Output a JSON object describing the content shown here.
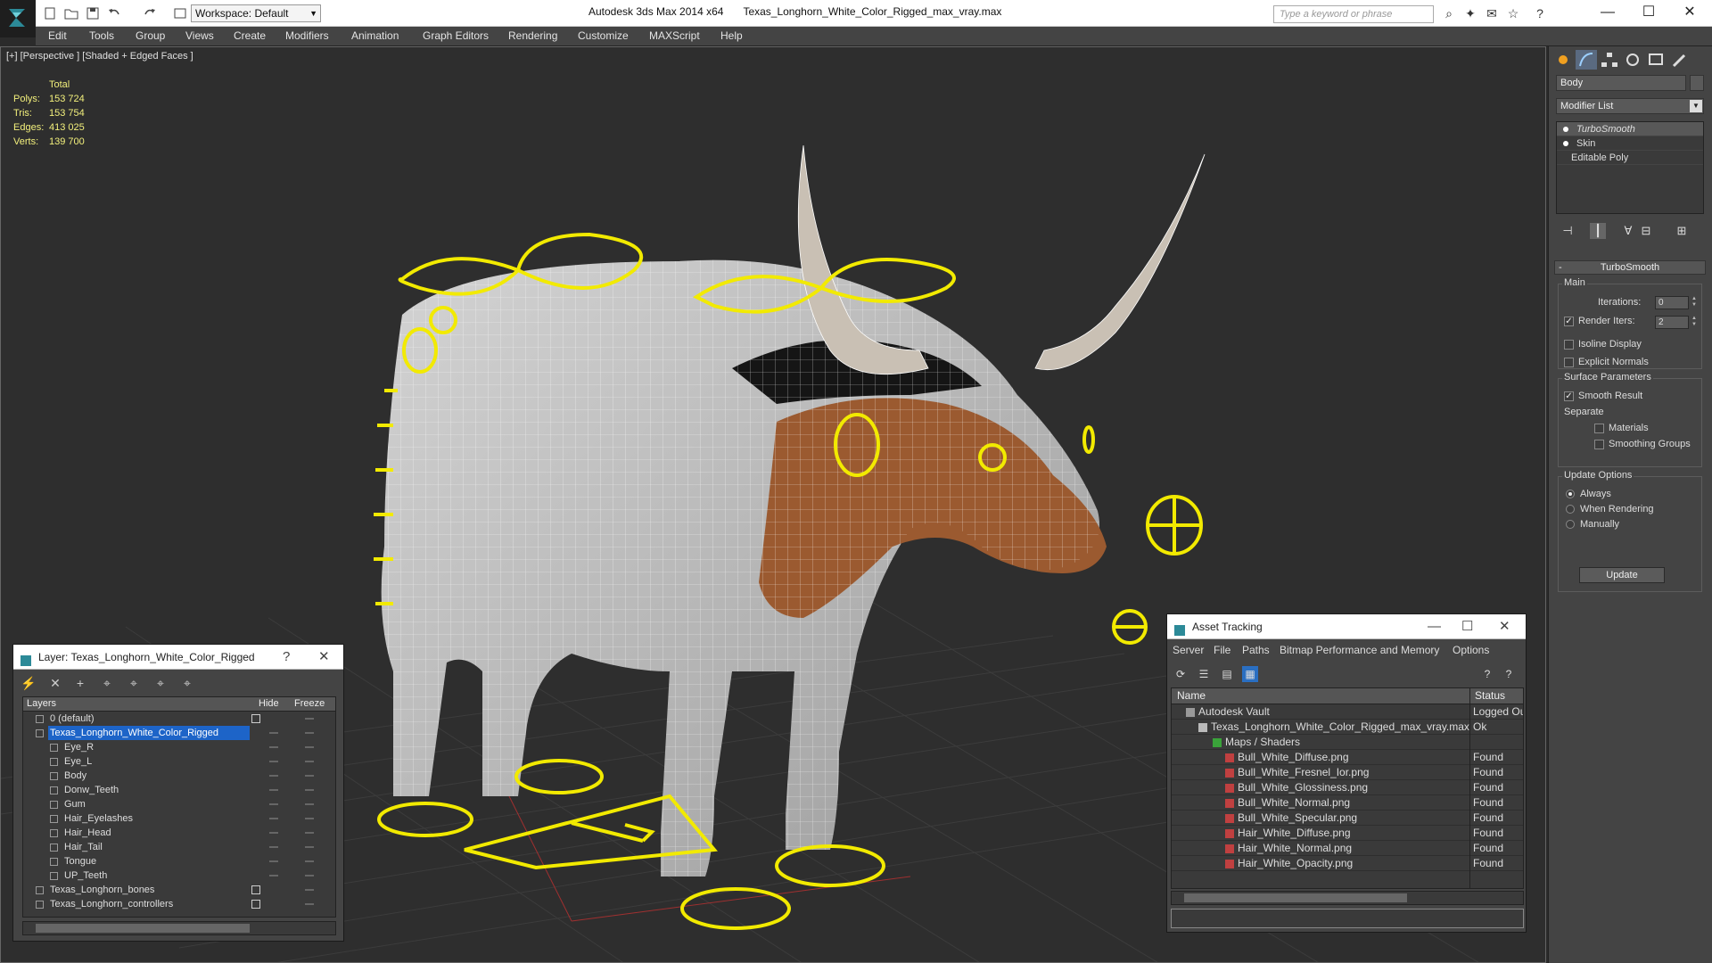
{
  "app": {
    "name": "Autodesk 3ds Max 2014 x64",
    "file": "Texas_Longhorn_White_Color_Rigged_max_vray.max",
    "workspace": "Workspace: Default",
    "search_placeholder": "Type a keyword or phrase"
  },
  "menu": [
    "Edit",
    "Tools",
    "Group",
    "Views",
    "Create",
    "Modifiers",
    "Animation",
    "Graph Editors",
    "Rendering",
    "Customize",
    "MAXScript",
    "Help"
  ],
  "viewport": {
    "label": "[+] [Perspective ] [Shaded + Edged Faces ]",
    "stats": {
      "header": "Total",
      "rows": [
        {
          "k": "Polys:",
          "v": "153 724"
        },
        {
          "k": "Tris:",
          "v": "153 754"
        },
        {
          "k": "Edges:",
          "v": "413 025"
        },
        {
          "k": "Verts:",
          "v": "139 700"
        }
      ]
    }
  },
  "command_panel": {
    "object_name": "Body",
    "modifier_list": "Modifier List",
    "stack": [
      "TurboSmooth",
      "Skin",
      "Editable Poly"
    ],
    "turbosmooth": {
      "title": "TurboSmooth",
      "main": "Main",
      "iterations_label": "Iterations:",
      "iterations": "0",
      "render_iters_label": "Render Iters:",
      "render_iters": "2",
      "isoline": "Isoline Display",
      "explicit_normals": "Explicit Normals",
      "surface_params": "Surface Parameters",
      "smooth_result": "Smooth Result",
      "separate": "Separate",
      "materials": "Materials",
      "smoothing_groups": "Smoothing Groups",
      "update_options": "Update Options",
      "always": "Always",
      "when_rendering": "When Rendering",
      "manually": "Manually",
      "update_button": "Update"
    }
  },
  "layer_window": {
    "title": "Layer: Texas_Longhorn_White_Color_Rigged",
    "help": "?",
    "columns": {
      "layers": "Layers",
      "hide": "Hide",
      "freeze": "Freeze"
    },
    "rows": [
      {
        "name": "0 (default)",
        "indent": 1
      },
      {
        "name": "Texas_Longhorn_White_Color_Rigged",
        "indent": 1,
        "selected": true
      },
      {
        "name": "Eye_R",
        "indent": 2
      },
      {
        "name": "Eye_L",
        "indent": 2
      },
      {
        "name": "Body",
        "indent": 2
      },
      {
        "name": "Donw_Teeth",
        "indent": 2
      },
      {
        "name": "Gum",
        "indent": 2
      },
      {
        "name": "Hair_Eyelashes",
        "indent": 2
      },
      {
        "name": "Hair_Head",
        "indent": 2
      },
      {
        "name": "Hair_Tail",
        "indent": 2
      },
      {
        "name": "Tongue",
        "indent": 2
      },
      {
        "name": "UP_Teeth",
        "indent": 2
      },
      {
        "name": "Texas_Longhorn_bones",
        "indent": 1
      },
      {
        "name": "Texas_Longhorn_controllers",
        "indent": 1
      }
    ]
  },
  "asset_window": {
    "title": "Asset Tracking",
    "menu": [
      "Server",
      "File",
      "Paths",
      "Bitmap Performance and Memory",
      "Options"
    ],
    "columns": {
      "name": "Name",
      "status": "Status"
    },
    "rows": [
      {
        "name": "Autodesk Vault",
        "status": "Logged Ou",
        "indent": 0
      },
      {
        "name": "Texas_Longhorn_White_Color_Rigged_max_vray.max",
        "status": "Ok",
        "indent": 1
      },
      {
        "name": "Maps / Shaders",
        "status": "",
        "indent": 2
      },
      {
        "name": "Bull_White_Diffuse.png",
        "status": "Found",
        "indent": 3
      },
      {
        "name": "Bull_White_Fresnel_Ior.png",
        "status": "Found",
        "indent": 3
      },
      {
        "name": "Bull_White_Glossiness.png",
        "status": "Found",
        "indent": 3
      },
      {
        "name": "Bull_White_Normal.png",
        "status": "Found",
        "indent": 3
      },
      {
        "name": "Bull_White_Specular.png",
        "status": "Found",
        "indent": 3
      },
      {
        "name": "Hair_White_Diffuse.png",
        "status": "Found",
        "indent": 3
      },
      {
        "name": "Hair_White_Normal.png",
        "status": "Found",
        "indent": 3
      },
      {
        "name": "Hair_White_Opacity.png",
        "status": "Found",
        "indent": 3
      }
    ]
  },
  "colors": {
    "controller": "#f2ea00",
    "selection": "#1d64c8",
    "panel": "#444444"
  }
}
